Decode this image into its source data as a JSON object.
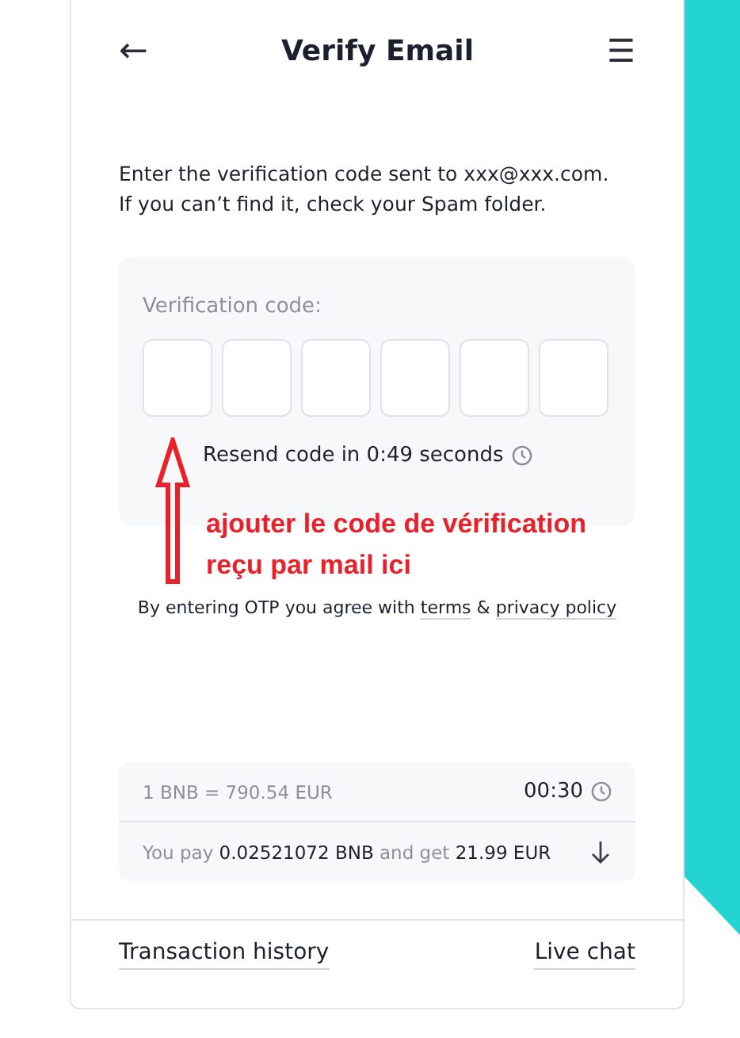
{
  "header": {
    "back_icon": "←",
    "title": "Verify Email",
    "menu_icon": "☰"
  },
  "intro": [
    "Enter the verification code sent to xxx@xxx.com.",
    "If you can’t find it, check your Spam folder."
  ],
  "code_panel": {
    "label": "Verification code:",
    "digits": [
      {
        "kind": "box"
      },
      {
        "kind": "box"
      },
      {
        "kind": "box"
      },
      {
        "kind": "box"
      },
      {
        "kind": "box"
      },
      {
        "kind": "box"
      }
    ],
    "resend": "Resend code in 0:49 seconds"
  },
  "annotation": {
    "text": [
      "ajouter le code de vérification",
      "reçu par mail ici"
    ]
  },
  "agreement": {
    "before": "By entering OTP you agree with",
    "link_1": "terms",
    "middle": "&",
    "link_2": "privacy policy"
  },
  "quote": {
    "rate": "1 BNB = 790.54 EUR",
    "timer": "00:30",
    "summary": "You pay **0.02521072 BNB** and get **21.99 EUR**"
  },
  "footer": {
    "left": "Transaction history",
    "right": "Live chat"
  }
}
